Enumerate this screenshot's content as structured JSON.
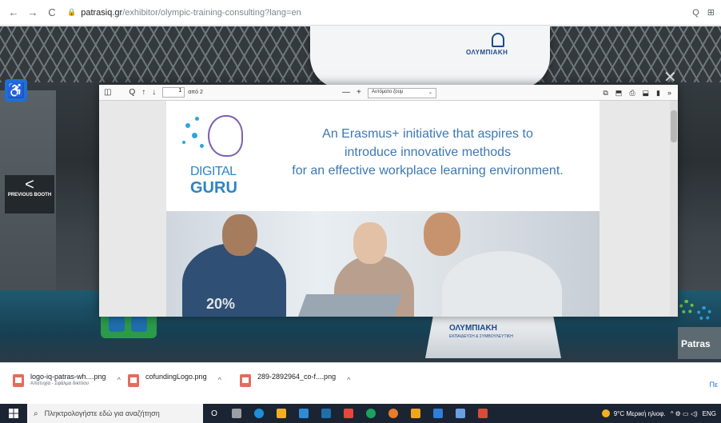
{
  "browser": {
    "url_domain": "patrasiq.gr",
    "url_path": "/exhibitor/olympic-training-consulting?lang=en",
    "back_icon": "←",
    "forward_icon": "→",
    "reload_icon": "C",
    "zoom_icon": "Q",
    "extension_icon": "⊞"
  },
  "scene": {
    "banner_logo_text": "ΟΛΥΜΠΙΑΚΗ",
    "desk_label": "ΟΛΥΜΠΙΑΚΗ",
    "desk_sub": "ΕΚΠΑΙΔΕΥΣΗ & ΣΥΜΒΟΥΛΕΥΤΙΚΗ",
    "patras_label": "Patras",
    "accessibility_icon": "♿",
    "prev_arrow": "<",
    "prev_label": "PREVIOUS BOOTH",
    "close_icon": "✕"
  },
  "pdf_viewer": {
    "sidebar_toggle_icon": "◫",
    "search_icon": "Q",
    "prev_page_icon": "↑",
    "next_page_icon": "↓",
    "page_number": "1",
    "page_of": "από 2",
    "zoom_out_icon": "—",
    "zoom_in_icon": "+",
    "zoom_value": "Αυτόματο ζουμ",
    "zoom_caret": "⌄",
    "tools": [
      "⧉",
      "⬒",
      "⎙",
      "⬓",
      "▮",
      "»"
    ]
  },
  "pdf_page": {
    "logo_word_1": "DIGITAL",
    "logo_word_2": "GURU",
    "tagline_line_1": "An Erasmus+ initiative that aspires to",
    "tagline_line_2": "introduce innovative methods",
    "tagline_line_3": "for an effective workplace learning environment.",
    "photo_overlay": "20%"
  },
  "downloads": [
    {
      "name": "logo-iq-patras-wh....png",
      "sub": "Αποτυχία - Σφάλμα δικτύου",
      "caret": "^"
    },
    {
      "name": "cofundingLogo.png",
      "sub": "",
      "caret": "^"
    },
    {
      "name": "289-2892964_co-f....png",
      "sub": "",
      "caret": "^"
    }
  ],
  "downloads_show_all": "Πε",
  "taskbar": {
    "search_placeholder": "Πληκτρολογήστε εδώ για αναζήτηση",
    "search_icon": "⌕",
    "task_view_icon": "O",
    "weather": "9°C Μερική ηλιοφ.",
    "tray_icons": "^ ⚙ ▭ ◁)",
    "language": "ENG",
    "app_colors": [
      "#9aa0a6",
      "#1f8fd8",
      "#f2b01e",
      "#2f8ad8",
      "#1f6fae",
      "#e8453c",
      "#1aa260",
      "#e87d2c",
      "#f0a51c",
      "#2f7ed8",
      "#6aa0e0",
      "#d84a3a"
    ]
  }
}
